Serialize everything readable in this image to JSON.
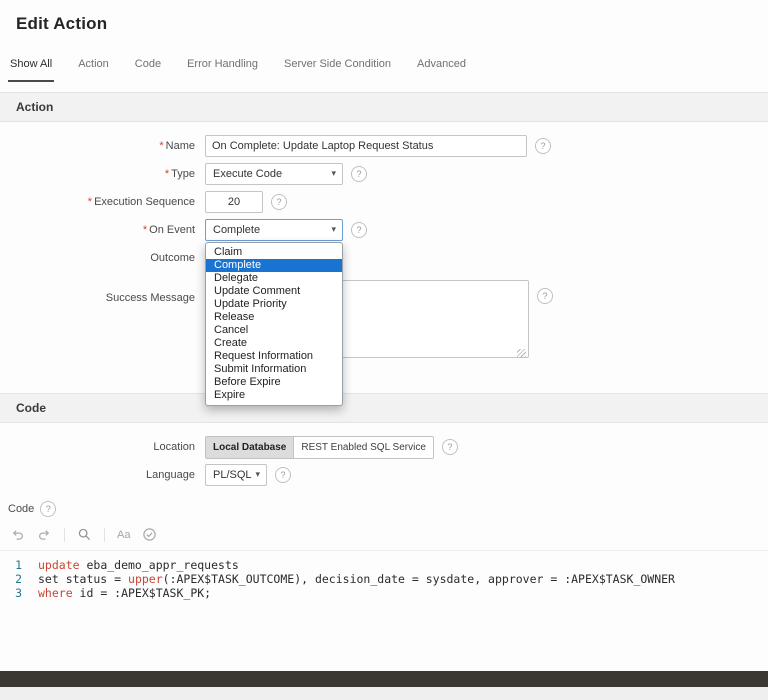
{
  "page": {
    "title": "Edit Action"
  },
  "ui": {
    "required_marker": "*",
    "help_glyph": "?",
    "select_chevron": "▾"
  },
  "tabs": [
    {
      "label": "Show All",
      "active": true
    },
    {
      "label": "Action",
      "active": false
    },
    {
      "label": "Code",
      "active": false
    },
    {
      "label": "Error Handling",
      "active": false
    },
    {
      "label": "Server Side Condition",
      "active": false
    },
    {
      "label": "Advanced",
      "active": false
    }
  ],
  "sections": {
    "action": {
      "title": "Action"
    },
    "code": {
      "title": "Code"
    }
  },
  "fields": {
    "name": {
      "label": "Name",
      "required": true,
      "value": "On Complete: Update Laptop Request Status"
    },
    "type": {
      "label": "Type",
      "required": true,
      "value": "Execute Code"
    },
    "execution_sequence": {
      "label": "Execution Sequence",
      "required": true,
      "value": "20"
    },
    "on_event": {
      "label": "On Event",
      "required": true,
      "value": "Complete"
    },
    "outcome": {
      "label": "Outcome"
    },
    "success_message": {
      "label": "Success Message",
      "value": ""
    },
    "location": {
      "label": "Location",
      "options": [
        "Local Database",
        "REST Enabled SQL Service"
      ],
      "selected": "Local Database"
    },
    "language": {
      "label": "Language",
      "value": "PL/SQL"
    }
  },
  "on_event_dropdown": {
    "selected": "Complete",
    "options": [
      "Claim",
      "Complete",
      "Delegate",
      "Update Comment",
      "Update Priority",
      "Release",
      "Cancel",
      "Create",
      "Request Information",
      "Submit Information",
      "Before Expire",
      "Expire"
    ]
  },
  "code_editor": {
    "label": "Code",
    "toolbar_icons": [
      "undo-icon",
      "redo-icon",
      "search-icon",
      "case-icon",
      "validate-icon"
    ],
    "case_icon_text": "Aa",
    "lines": [
      {
        "number": 1,
        "tokens": [
          {
            "text": "update ",
            "type": "keyword"
          },
          {
            "text": "eba_demo_appr_requests",
            "type": "plain"
          }
        ]
      },
      {
        "number": 2,
        "tokens": [
          {
            "text": "set status = ",
            "type": "plain"
          },
          {
            "text": "upper",
            "type": "keyword"
          },
          {
            "text": "(:APEX$TASK_OUTCOME), decision_date = sysdate, approver = :APEX$TASK_OWNER",
            "type": "plain"
          }
        ]
      },
      {
        "number": 3,
        "tokens": [
          {
            "text": "where ",
            "type": "keyword"
          },
          {
            "text": "id = :APEX$TASK_PK;",
            "type": "plain"
          }
        ]
      }
    ]
  },
  "colors": {
    "accent_blue": "#1a73d1",
    "keyword_red": "#c74634",
    "required_red": "#d43f3a",
    "section_bg": "#f2f2f2",
    "footer_dark": "#3b3733"
  }
}
